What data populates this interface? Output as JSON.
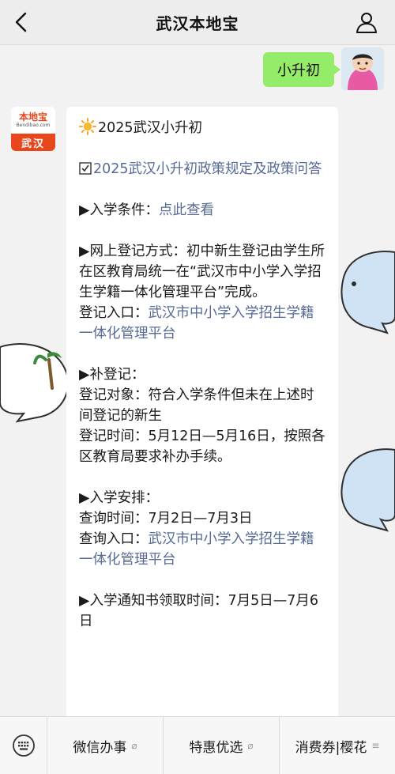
{
  "header": {
    "title": "武汉本地宝"
  },
  "user_message": {
    "text": "小升初"
  },
  "bot_avatar": {
    "logo": "本地宝",
    "logo_sub": "Bendibao.com",
    "city": "武汉"
  },
  "message": {
    "heading": "2025武汉小升初",
    "policy_link": "2025武汉小升初政策规定及政策问答",
    "s1_label": "▶入学条件：",
    "s1_link": "点此查看",
    "s2_text": "▶网上登记方式：初中新生登记由学生所在区教育局统一在“武汉市中小学入学招生学籍一体化管理平台”完成。",
    "s2_entry_label": "登记入口：",
    "s2_entry_link": "武汉市中小学入学招生学籍一体化管理平台",
    "s3_title": "▶补登记：",
    "s3_target": "登记对象：符合入学条件但未在上述时间登记的新生",
    "s3_time": "登记时间：5月12日—5月16日，按照各区教育局要求补办手续。",
    "s4_title": "▶入学安排：",
    "s4_time": "查询时间：7月2日—7月3日",
    "s4_entry_label": "查询入口：",
    "s4_entry_link": "武汉市中小学入学招生学籍一体化管理平台",
    "s5_text": "▶入学通知书领取时间：7月5日—7月6日"
  },
  "menu": {
    "keyboard_icon": "keyboard-icon",
    "items": [
      {
        "label": "微信办事",
        "icon": "link-icon"
      },
      {
        "label": "特惠优选",
        "icon": "link-icon"
      },
      {
        "label": "消费券|樱花",
        "icon": "menu-lines-icon"
      }
    ]
  },
  "colors": {
    "bubble_green": "#95ec69",
    "link_blue": "#576b95",
    "brand_orange": "#e8471d"
  }
}
